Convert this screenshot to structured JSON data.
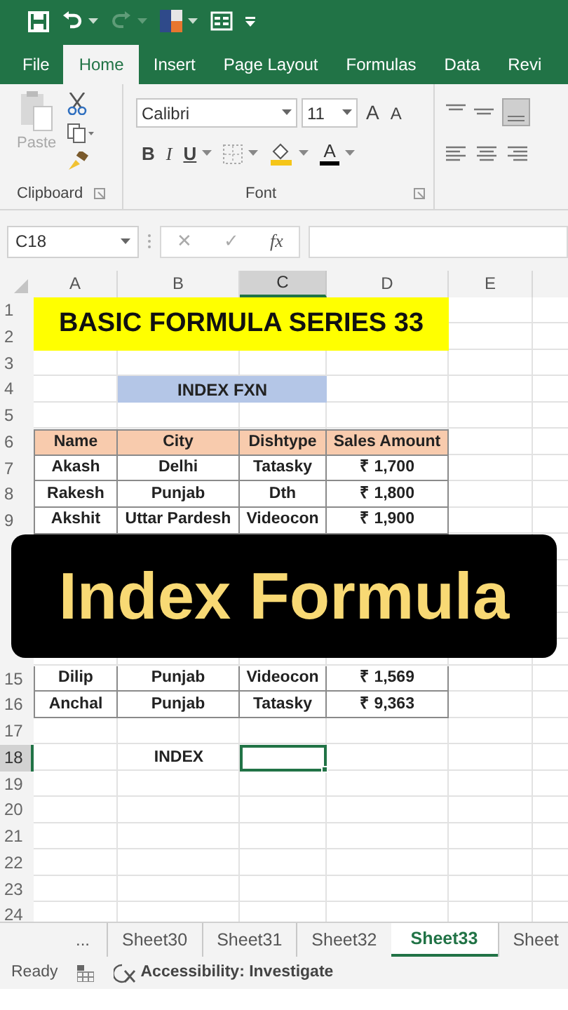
{
  "quick_access": [
    {
      "kind": "save",
      "disabled": false
    },
    {
      "kind": "undo",
      "disabled": false
    },
    {
      "kind": "redo",
      "disabled": true
    },
    {
      "kind": "theme",
      "disabled": false
    },
    {
      "kind": "form",
      "disabled": false
    },
    {
      "kind": "customize",
      "disabled": false
    }
  ],
  "ribbon_tabs": [
    {
      "label": "File",
      "selected": false
    },
    {
      "label": "Home",
      "selected": true
    },
    {
      "label": "Insert",
      "selected": false
    },
    {
      "label": "Page Layout",
      "selected": false
    },
    {
      "label": "Formulas",
      "selected": false
    },
    {
      "label": "Data",
      "selected": false
    },
    {
      "label": "Revi",
      "selected": false
    }
  ],
  "clipboard": {
    "paste_label": "Paste",
    "paste_disabled": true,
    "group_label": "Clipboard"
  },
  "font": {
    "name": "Calibri",
    "size": "11",
    "grow": "A",
    "shrink": "A",
    "bold": "B",
    "italic": "I",
    "underline": "U",
    "color_letter": "A",
    "group_label": "Font"
  },
  "formula_bar": {
    "name_box": "C18",
    "cancel": "✕",
    "enter": "✓",
    "function": "fx"
  },
  "columns": [
    {
      "label": "A",
      "selected": false
    },
    {
      "label": "B",
      "selected": false
    },
    {
      "label": "C",
      "selected": true
    },
    {
      "label": "D",
      "selected": false
    },
    {
      "label": "E",
      "selected": false
    }
  ],
  "rows": [
    {
      "label": "1",
      "selected": false,
      "cells": [
        {
          "kind": "title",
          "text": "BASIC FORMULA SERIES 33"
        }
      ]
    },
    {
      "label": "2",
      "selected": false
    },
    {
      "label": "3",
      "selected": false
    },
    {
      "label": "4",
      "selected": false,
      "cells": [
        null,
        {
          "kind": "label",
          "text": "INDEX FXN"
        }
      ]
    },
    {
      "label": "5",
      "selected": false
    },
    {
      "label": "6",
      "selected": false,
      "cells": [
        {
          "kind": "header",
          "text": "Name"
        },
        {
          "kind": "header",
          "text": "City"
        },
        {
          "kind": "header",
          "text": "Dishtype"
        },
        {
          "kind": "header",
          "text": "Sales Amount"
        }
      ]
    },
    {
      "label": "7",
      "selected": false,
      "cells": [
        {
          "kind": "data",
          "text": "Akash"
        },
        {
          "kind": "data",
          "text": "Delhi"
        },
        {
          "kind": "data",
          "text": "Tatasky"
        },
        {
          "kind": "data",
          "text": "₹ 1,700"
        }
      ]
    },
    {
      "label": "8",
      "selected": false,
      "cells": [
        {
          "kind": "data",
          "text": "Rakesh"
        },
        {
          "kind": "data",
          "text": "Punjab"
        },
        {
          "kind": "data",
          "text": "Dth"
        },
        {
          "kind": "data",
          "text": "₹ 1,800"
        }
      ]
    },
    {
      "label": "9",
      "selected": false,
      "cells": [
        {
          "kind": "data",
          "text": "Akshit"
        },
        {
          "kind": "data",
          "text": "Uttar Pardesh"
        },
        {
          "kind": "data",
          "text": "Videocon"
        },
        {
          "kind": "data",
          "text": "₹ 1,900"
        }
      ],
      "caption_below": "Index Formula"
    },
    {
      "label": "15",
      "selected": false,
      "cells": [
        {
          "kind": "data",
          "text": "Dilip"
        },
        {
          "kind": "data",
          "text": "Punjab"
        },
        {
          "kind": "data",
          "text": "Videocon"
        },
        {
          "kind": "data",
          "text": "₹ 1,569"
        }
      ]
    },
    {
      "label": "16",
      "selected": false,
      "cells": [
        {
          "kind": "data",
          "text": "Anchal"
        },
        {
          "kind": "data",
          "text": "Punjab"
        },
        {
          "kind": "data",
          "text": "Tatasky"
        },
        {
          "kind": "data",
          "text": "₹ 9,363"
        }
      ]
    },
    {
      "label": "17",
      "selected": false
    },
    {
      "label": "18",
      "selected": true,
      "cells": [
        null,
        {
          "kind": "plain",
          "text": "INDEX"
        },
        {
          "kind": "active"
        }
      ]
    },
    {
      "label": "19",
      "selected": false
    },
    {
      "label": "20",
      "selected": false
    },
    {
      "label": "21",
      "selected": false
    },
    {
      "label": "22",
      "selected": false
    },
    {
      "label": "23",
      "selected": false
    },
    {
      "label": "24",
      "selected": false
    }
  ],
  "sheet_nav_more": "...",
  "sheet_tabs": [
    {
      "label": "Sheet30",
      "selected": false
    },
    {
      "label": "Sheet31",
      "selected": false
    },
    {
      "label": "Sheet32",
      "selected": false
    },
    {
      "label": "Sheet33",
      "selected": true
    },
    {
      "label": "Sheet",
      "selected": false
    }
  ],
  "status_bar": {
    "mode": "Ready",
    "accessibility": "Accessibility: Investigate"
  }
}
